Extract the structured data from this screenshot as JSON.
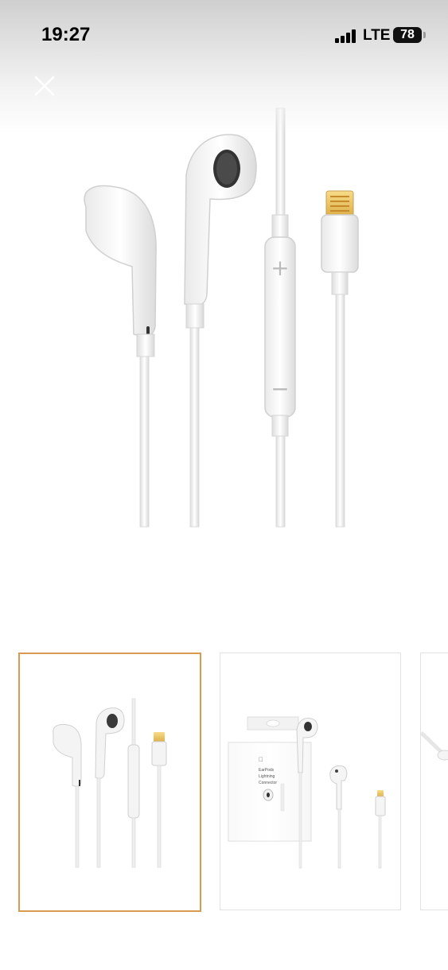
{
  "status_bar": {
    "time": "19:27",
    "network": "LTE",
    "battery": "78"
  },
  "viewer": {
    "close_icon": "close-icon",
    "main_image": "earpods-lightning-product-photo",
    "thumbnails": [
      {
        "image": "earpods-front-view",
        "selected": true
      },
      {
        "image": "earpods-with-box",
        "selected": false
      },
      {
        "image": "earpods-cable-detail",
        "selected": false
      }
    ]
  },
  "box_label": {
    "line1": "EarPods",
    "line2": "Lightning",
    "line3": "Connector"
  },
  "colors": {
    "selected_border": "#d99a52",
    "thumb_border": "#e2e2e2"
  }
}
